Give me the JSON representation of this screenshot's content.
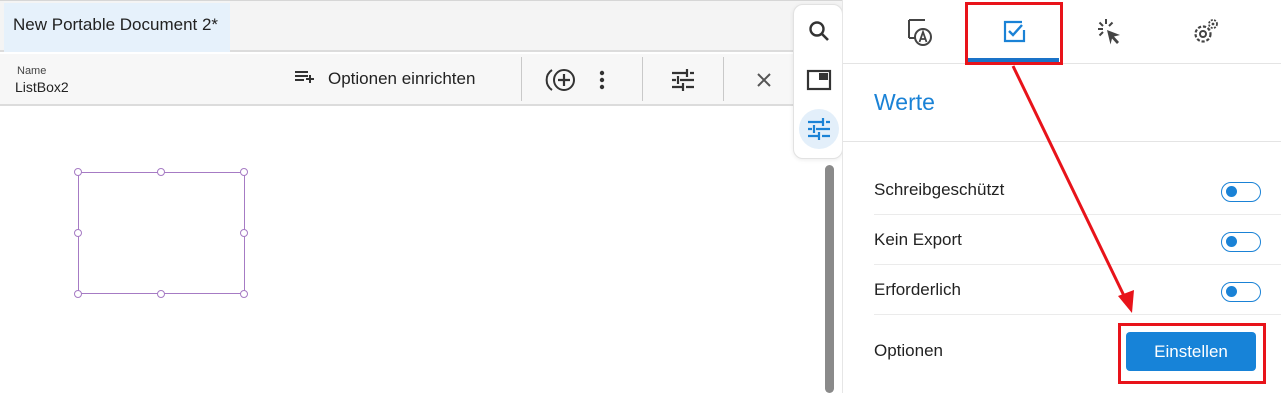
{
  "document": {
    "tab_title": "New Portable Document 2*"
  },
  "properties_bar": {
    "name_label": "Name",
    "name_value": "ListBox2",
    "options_button_label": "Optionen einrichten",
    "icons": [
      "playlist-add-icon",
      "add-circle-icon",
      "more-vert-icon",
      "tune-icon",
      "close-icon"
    ]
  },
  "tool_strip": {
    "icons": [
      "search-icon",
      "picture-in-picture-icon",
      "tune-icon"
    ],
    "active": "tune-icon"
  },
  "panel": {
    "tabs": [
      {
        "icon": "form-text-icon"
      },
      {
        "icon": "checkbox-icon",
        "active": true
      },
      {
        "icon": "cursor-click-icon"
      },
      {
        "icon": "gear-icon"
      }
    ],
    "section_title": "Werte",
    "rows": [
      {
        "label": "Schreibgeschützt",
        "toggle_on": false
      },
      {
        "label": "Kein Export",
        "toggle_on": false
      },
      {
        "label": "Erforderlich",
        "toggle_on": false
      }
    ],
    "options_label": "Optionen",
    "options_button_label": "Einstellen"
  },
  "colors": {
    "accent": "#1a82d6",
    "annotation": "#e8131a",
    "selection": "#a67bc4"
  }
}
